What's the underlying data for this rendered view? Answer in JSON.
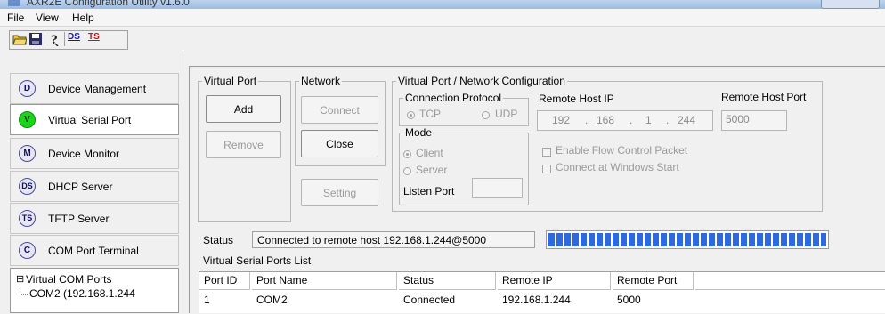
{
  "window": {
    "title": "AXR2E Configuration Utility v1.6.0"
  },
  "menu": [
    "File",
    "View",
    "Help"
  ],
  "toolbar": {
    "buttons": [
      {
        "icon": "open-folder-icon"
      },
      {
        "icon": "save-disk-icon"
      },
      {
        "icon": "help-icon"
      },
      {
        "icon": "ds-icon",
        "label": "DS"
      },
      {
        "icon": "ts-icon",
        "label": "TS"
      }
    ]
  },
  "sidebar": {
    "items": [
      {
        "badge": "D",
        "label": "Device Management",
        "active": false
      },
      {
        "badge": "V",
        "label": "Virtual Serial Port",
        "active": true
      },
      {
        "badge": "M",
        "label": "Device Monitor",
        "active": false
      },
      {
        "badge": "DS",
        "label": "DHCP Server",
        "active": false
      },
      {
        "badge": "TS",
        "label": "TFTP Server",
        "active": false
      },
      {
        "badge": "C",
        "label": "COM Port Terminal",
        "active": false
      }
    ],
    "tree": {
      "root": "Virtual COM Ports",
      "expander": "⊟",
      "children": [
        "COM2 (192.168.1.244"
      ]
    }
  },
  "virtual_port": {
    "title": "Virtual Port",
    "add_label": "Add",
    "remove_label": "Remove"
  },
  "network": {
    "title": "Network",
    "connect_label": "Connect",
    "close_label": "Close",
    "setting_label": "Setting"
  },
  "config": {
    "title": "Virtual Port / Network Configuration",
    "protocol": {
      "title": "Connection Protocol",
      "tcp": "TCP",
      "udp": "UDP",
      "selected": "TCP"
    },
    "mode": {
      "title": "Mode",
      "client": "Client",
      "server": "Server",
      "selected": "Client"
    },
    "listen_port_label": "Listen Port",
    "listen_port_value": "",
    "remote_host_ip_label": "Remote Host IP",
    "remote_host_ip": [
      "192",
      "168",
      "1",
      "244"
    ],
    "remote_host_port_label": "Remote Host Port",
    "remote_host_port": "5000",
    "flow_control_label": "Enable Flow Control Packet",
    "connect_at_start_label": "Connect at Windows Start"
  },
  "status": {
    "label": "Status",
    "text": "Connected to remote host 192.168.1.244@5000",
    "progress": 1.0
  },
  "list": {
    "title": "Virtual Serial Ports List",
    "columns": [
      "Port ID",
      "Port Name",
      "Status",
      "Remote IP",
      "Remote Port"
    ],
    "rows": [
      [
        "1",
        "COM2",
        "Connected",
        "192.168.1.244",
        "5000"
      ]
    ]
  },
  "colors": {
    "accent": "#2d6ae0",
    "active_badge": "#1bd51b",
    "title_bar": "#bcd3ee"
  }
}
